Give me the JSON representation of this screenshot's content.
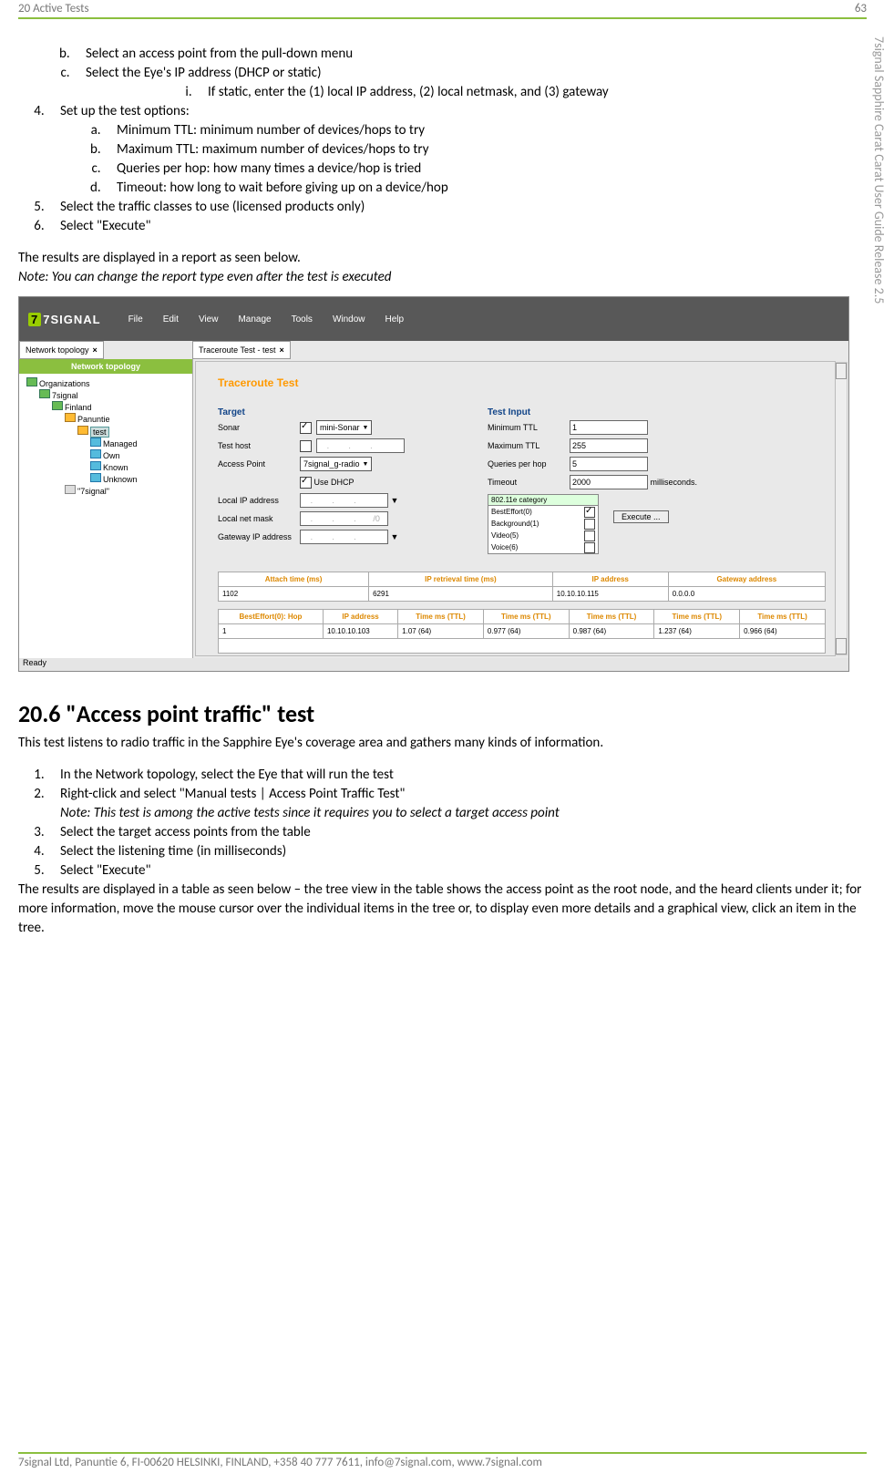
{
  "header": {
    "left": "20 Active Tests",
    "right": "63"
  },
  "side_title": "7signal Sapphire Carat Carat User Guide Release 2.5",
  "list_top": {
    "sub_bc": [
      "Select an access point from the pull-down menu",
      "Select the Eye's IP address (DHCP or static)"
    ],
    "roman_i": "If static, enter the (1) local IP address, (2) local netmask, and (3) gateway",
    "item4_intro": "Set up the test options:",
    "item4_sub": [
      "Minimum TTL: minimum number of devices/hops to try",
      "Maximum TTL: maximum number of devices/hops to try",
      "Queries per hop: how many times a device/hop is tried",
      "Timeout: how long to wait before giving up on a device/hop"
    ],
    "item5": "Select the traffic classes to use (licensed products only)",
    "item6": "Select \"Execute\""
  },
  "para1": "The results are displayed in a report as seen below.",
  "note1": "Note: You can change the report type even after the test is executed",
  "screenshot": {
    "logo": "7SIGNAL",
    "menu": [
      "File",
      "Edit",
      "View",
      "Manage",
      "Tools",
      "Window",
      "Help"
    ],
    "tab_left": "Network topology",
    "tab_right": "Traceroute Test - test",
    "side_title": "Network topology",
    "tree": {
      "org": "Organizations",
      "n1": "7signal",
      "n2": "Finland",
      "n3": "Panuntie",
      "sel": "test",
      "c": [
        "Managed",
        "Own",
        "Known",
        "Unknown",
        "\"7signal\""
      ]
    },
    "main_title": "Traceroute Test",
    "left_col": {
      "h": "Target",
      "sonar_l": "Sonar",
      "sonar_v": "mini-Sonar",
      "th_l": "Test host",
      "ap_l": "Access Point",
      "ap_v": "7signal_g-radio",
      "dhcp": "Use DHCP",
      "lip": "Local IP address",
      "lnm": "Local net mask",
      "gip": "Gateway IP address"
    },
    "right_col": {
      "h": "Test Input",
      "min_l": "Minimum TTL",
      "min_v": "1",
      "max_l": "Maximum TTL",
      "max_v": "255",
      "q_l": "Queries per hop",
      "q_v": "5",
      "t_l": "Timeout",
      "t_v": "2000",
      "t_u": "milliseconds.",
      "cat_h": "802.11e category",
      "cats": [
        {
          "n": "BestEffort(0)",
          "c": true
        },
        {
          "n": "Background(1)",
          "c": false
        },
        {
          "n": "Video(5)",
          "c": false
        },
        {
          "n": "Voice(6)",
          "c": false
        }
      ],
      "exec": "Execute ..."
    },
    "table1": {
      "headers": [
        "Attach time (ms)",
        "IP retrieval time (ms)",
        "IP address",
        "Gateway address"
      ],
      "row": [
        "1102",
        "6291",
        "10.10.10.115",
        "0.0.0.0"
      ]
    },
    "table2": {
      "headers": [
        "BestEffort(0): Hop",
        "IP address",
        "Time ms (TTL)",
        "Time ms (TTL)",
        "Time ms (TTL)",
        "Time ms (TTL)",
        "Time ms (TTL)"
      ],
      "row": [
        "1",
        "10.10.10.103",
        "1.07 (64)",
        "0.977 (64)",
        "0.987 (64)",
        "1.237 (64)",
        "0.966 (64)"
      ]
    },
    "status": "Ready"
  },
  "section_h": "20.6 \"Access point traffic\" test",
  "para2": "This test listens to radio traffic in the Sapphire Eye's coverage area and gathers many kinds of information.",
  "list2": {
    "i1": "In the Network topology, select the Eye that will run the test",
    "i2": "Right-click and select \"Manual tests | Access Point Traffic Test\"",
    "i2n": "Note: This test is among the active tests since it requires you to select a target access point",
    "i3": "Select the target access points from the table",
    "i4": "Select the listening time (in milliseconds)",
    "i5": "Select \"Execute\""
  },
  "para3": "The results are displayed in a table as seen below – the tree view in the table shows the access point as the root node, and the heard clients under it; for more information, move the mouse cursor over the individual items in the tree or, to display even more details and a graphical view, click an item in the tree.",
  "footer": "7signal Ltd, Panuntie 6, FI-00620 HELSINKI, FINLAND, +358 40 777 7611, info@7signal.com, www.7signal.com",
  "chart_data": {
    "type": "table",
    "tables": [
      {
        "headers": [
          "Attach time (ms)",
          "IP retrieval time (ms)",
          "IP address",
          "Gateway address"
        ],
        "rows": [
          [
            "1102",
            "6291",
            "10.10.10.115",
            "0.0.0.0"
          ]
        ]
      },
      {
        "headers": [
          "BestEffort(0): Hop",
          "IP address",
          "Time ms (TTL)",
          "Time ms (TTL)",
          "Time ms (TTL)",
          "Time ms (TTL)",
          "Time ms (TTL)"
        ],
        "rows": [
          [
            "1",
            "10.10.10.103",
            "1.07 (64)",
            "0.977 (64)",
            "0.987 (64)",
            "1.237 (64)",
            "0.966 (64)"
          ]
        ]
      }
    ]
  }
}
